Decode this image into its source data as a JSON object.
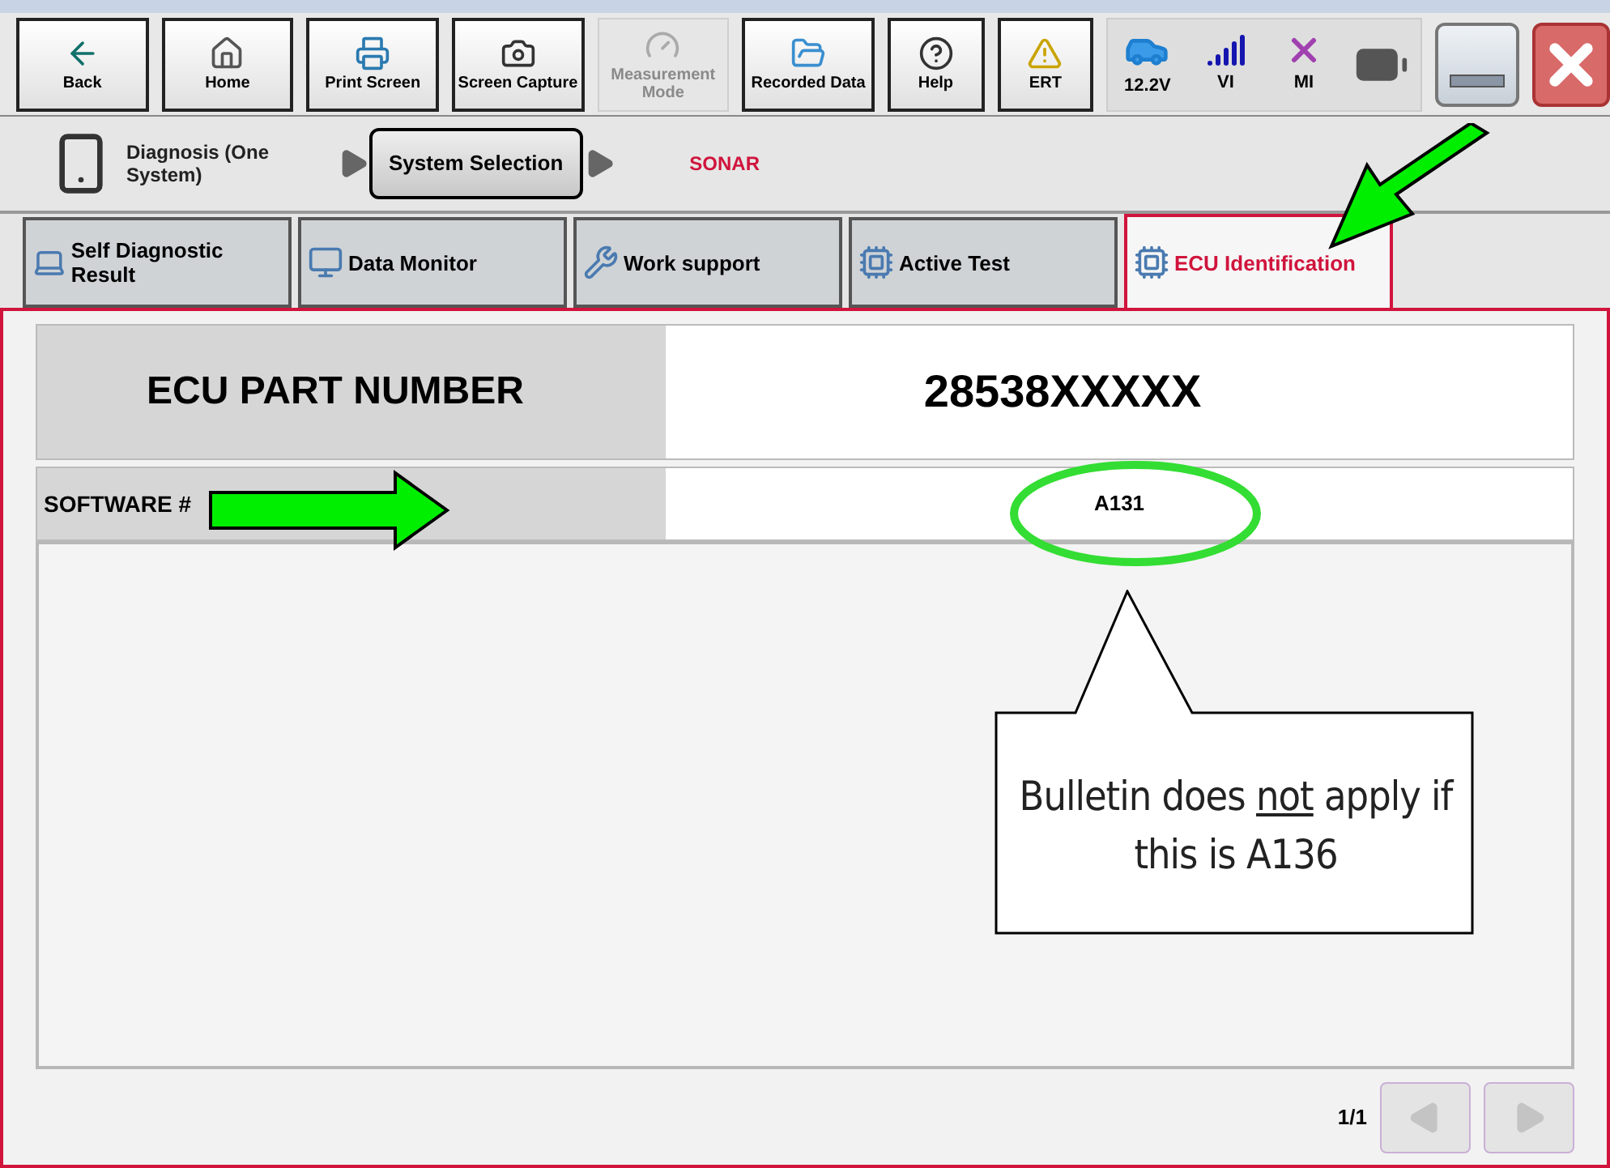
{
  "toolbar": {
    "buttons": [
      {
        "kind": "back",
        "label": "Back",
        "disabled": false
      },
      {
        "kind": "home",
        "label": "Home",
        "disabled": false
      },
      {
        "kind": "print",
        "label": "Print Screen",
        "disabled": false
      },
      {
        "kind": "camera",
        "label": "Screen Capture",
        "disabled": false
      },
      {
        "kind": "meter",
        "label": "Measurement Mode",
        "disabled": true
      },
      {
        "kind": "folders",
        "label": "Recorded Data",
        "disabled": false
      },
      {
        "kind": "help",
        "label": "Help",
        "disabled": false
      },
      {
        "kind": "warning",
        "label": "ERT",
        "disabled": false
      }
    ],
    "states": [
      {
        "kind": "car",
        "label": "12.2V"
      },
      {
        "kind": "signal",
        "label": "VI"
      },
      {
        "kind": "cross",
        "label": "MI"
      },
      {
        "kind": "battery"
      }
    ]
  },
  "breadcrumb": {
    "items": [
      {
        "kind": "text",
        "label": "Diagnosis (One System)"
      },
      {
        "kind": "button",
        "label": "System Selection"
      },
      {
        "kind": "current",
        "label": "SONAR"
      }
    ]
  },
  "tabs": [
    {
      "kind": "self",
      "label": "Self Diagnostic Result",
      "selected": false
    },
    {
      "kind": "monitor",
      "label": "Data Monitor",
      "selected": false
    },
    {
      "kind": "work",
      "label": "Work support",
      "selected": false
    },
    {
      "kind": "active",
      "label": "Active Test",
      "selected": false
    },
    {
      "kind": "ecu",
      "label": "ECU Identification",
      "selected": true
    }
  ],
  "table": {
    "rows": [
      {
        "kind": "large",
        "label": "ECU PART NUMBER",
        "value": "28538XXXXX"
      },
      {
        "kind": "small",
        "label": "SOFTWARE #",
        "value": "A131"
      }
    ]
  },
  "pager": {
    "page": "1/1",
    "prev_disabled": true,
    "next_disabled": true
  },
  "callout": {
    "before": "Bulletin does",
    "emphasis": "not",
    "after": "apply if this is A136"
  }
}
